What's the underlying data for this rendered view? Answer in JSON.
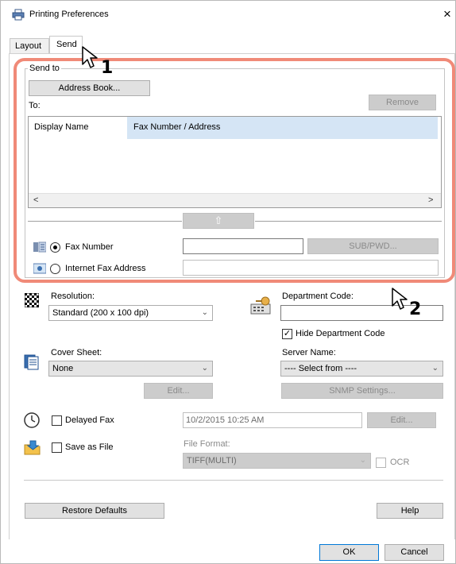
{
  "window": {
    "title": "Printing Preferences",
    "close_glyph": "×"
  },
  "tabs": [
    {
      "label": "Layout"
    },
    {
      "label": "Send",
      "active": true
    }
  ],
  "send_to": {
    "group_label": "Send to",
    "address_book_button": "Address Book...",
    "to_label": "To:",
    "remove_button": "Remove",
    "table_headers": [
      "Display Name",
      "Fax Number / Address"
    ],
    "scroll_left": "<",
    "scroll_right": ">",
    "up_arrow": "⇧",
    "fax_number_label": "Fax Number",
    "fax_number_value": "",
    "sub_pwd_button": "SUB/PWD...",
    "internet_fax_label": "Internet Fax Address",
    "internet_fax_value": ""
  },
  "resolution": {
    "label": "Resolution:",
    "value": "Standard (200 x 100 dpi)"
  },
  "department": {
    "label": "Department Code:",
    "value": "",
    "hide_label": "Hide Department Code",
    "hide_checked": true
  },
  "cover_sheet": {
    "label": "Cover Sheet:",
    "value": "None",
    "edit_button": "Edit..."
  },
  "server": {
    "label": "Server Name:",
    "value": "---- Select from ----",
    "snmp_button": "SNMP Settings..."
  },
  "delayed_fax": {
    "label": "Delayed Fax",
    "datetime": "10/2/2015 10:25 AM",
    "edit_button": "Edit..."
  },
  "save_as_file": {
    "label": "Save as File",
    "format_label": "File Format:",
    "format_value": "TIFF(MULTI)",
    "ocr_label": "OCR"
  },
  "footer": {
    "restore_defaults": "Restore Defaults",
    "help": "Help",
    "ok": "OK",
    "cancel": "Cancel"
  },
  "callouts": {
    "step1": "1",
    "step2": "2",
    "highlight_color": "#f08a78"
  }
}
